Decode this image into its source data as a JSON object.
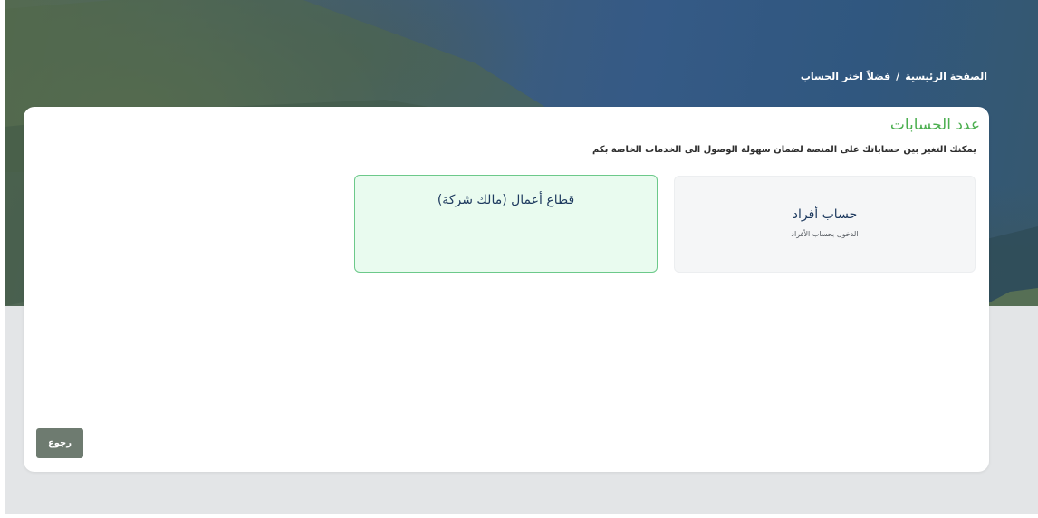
{
  "breadcrumb": {
    "home": "الصفحة الرئيسية",
    "separator": "/",
    "current": "فضلاً اختر الحساب"
  },
  "card": {
    "title": "عدد الحسابات",
    "subtitle": "يمكنك التغير بين حساباتك على المنصة لضمان سهولة الوصول الى الخدمات الخاصة بكم"
  },
  "options": {
    "individual": {
      "title": "حساب أفراد",
      "description": "الدخول بحساب الأفراد"
    },
    "business": {
      "title": "قطاع أعمال (مالك شركة)"
    }
  },
  "actions": {
    "back_label": "رجوع"
  },
  "colors": {
    "accent_green": "#4caf50",
    "selected_border": "#6cc98a",
    "selected_bg": "#e9fbef",
    "back_button": "#6e7b70"
  }
}
